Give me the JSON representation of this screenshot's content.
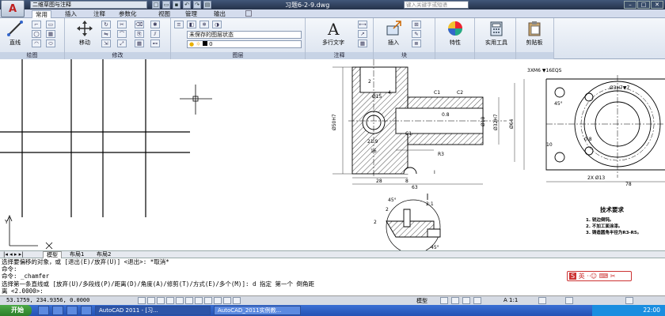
{
  "title_bar": {
    "workspace": "二维草图与注释",
    "document_title": "习题6-2-9.dwg",
    "search_placeholder": "键入关键字或短语"
  },
  "tabs": [
    "常用",
    "插入",
    "注释",
    "参数化",
    "视图",
    "管理",
    "输出"
  ],
  "ribbon": {
    "line_button": "直线",
    "move_button": "移动",
    "layer_state": "未保存的图层状态",
    "layer_current": "0",
    "multiline_text": "多行文字",
    "insert_button": "插入",
    "properties_button": "特性",
    "utilities_button": "实用工具",
    "clipboard_button": "剪贴板",
    "panels": {
      "draw": "绘图",
      "modify": "修改",
      "layers": "图层",
      "annotation": "注释",
      "block": "块"
    }
  },
  "drawing": {
    "dims": {
      "c1a": "C1",
      "c2": "C2",
      "d0_8a": "0.8",
      "d4": "4",
      "ra": "2",
      "d15": "Ø15",
      "d50h7": "Ø50H7",
      "d21_9": "21.9",
      "d16": "16",
      "c1b": "C1",
      "r3": "R3",
      "d28": "28",
      "d8": "8",
      "d63": "63",
      "roman": "I",
      "d32h7": "Ø32H7",
      "d18": "Ø18",
      "d64": "Ø64",
      "d2x13": "2X Ø13",
      "d78": "78",
      "thread": "3XM6 ▼16EQS",
      "d3h7": "Ø3H7▼7",
      "ang45": "45°",
      "d10": "10",
      "d0_8b": "0.8",
      "d2_1": "2:1",
      "d2a": "2",
      "d2b": "2",
      "d45b": "45°",
      "d45c": "45°"
    },
    "tech_req": {
      "title": "技术要求",
      "items": [
        "1. 锐边倒钝。",
        "2. 不加工面涂漆。",
        "3. 铸造圆角半径为R3-R5。"
      ]
    }
  },
  "layout_tabs": [
    "模型",
    "布局1",
    "布局2"
  ],
  "command_lines": [
    "选择要偏移的对象，或 [退出(E)/放弃(U)] <退出>:  *取消*",
    "命令:",
    "命令: _chamfer",
    "选择第一条直线或 [放弃(U)/多段线(P)/距离(D)/角度(A)/修剪(T)/方式(E)/多个(M)]:  d 指定 第一个 倒角距",
    "离 <2.0000>:"
  ],
  "status": {
    "coords": "53.1759, 234.9356, 0.0000",
    "model_label": "模型",
    "scale": "A 1:1"
  },
  "ime": "英",
  "taskbar": {
    "start": "开始",
    "tasks": [
      "",
      "AutoCAD 2011 - [习...",
      "AutoCAD_2011实例教..."
    ],
    "time": "22:00"
  }
}
